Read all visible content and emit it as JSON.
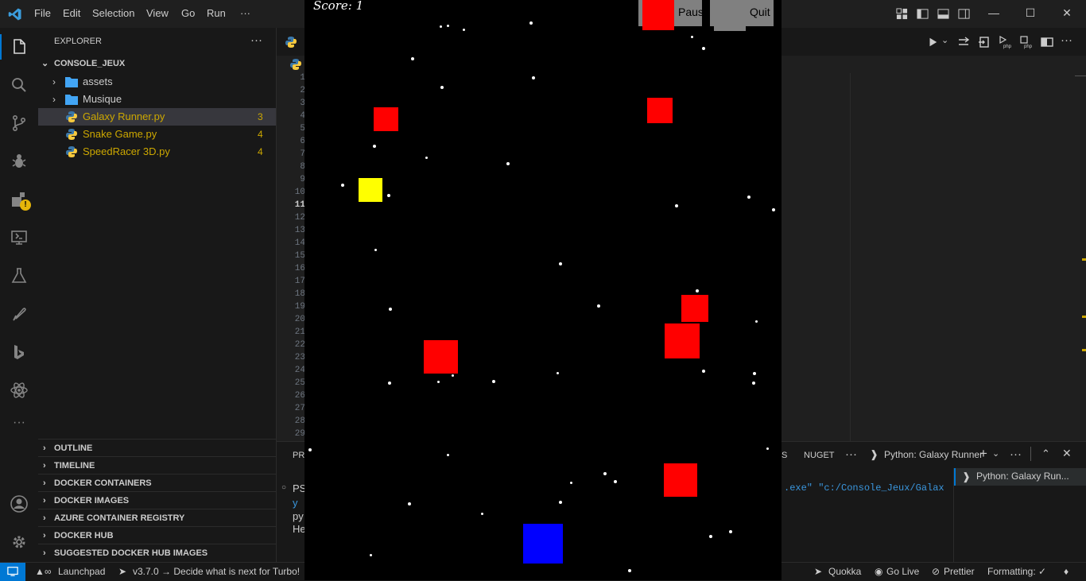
{
  "titlebar": {
    "menu": [
      "File",
      "Edit",
      "Selection",
      "View",
      "Go",
      "Run",
      "···"
    ]
  },
  "sidebar": {
    "header": "EXPLORER",
    "more": "···",
    "root": "CONSOLE_JEUX",
    "folders": [
      "assets",
      "Musique"
    ],
    "files": [
      {
        "name": "Galaxy Runner.py",
        "badge": "3"
      },
      {
        "name": "Snake Game.py",
        "badge": "4"
      },
      {
        "name": "SpeedRacer 3D.py",
        "badge": "4"
      }
    ],
    "sections": [
      "OUTLINE",
      "TIMELINE",
      "DOCKER CONTAINERS",
      "DOCKER IMAGES",
      "AZURE CONTAINER REGISTRY",
      "DOCKER HUB",
      "SUGGESTED DOCKER HUB IMAGES"
    ]
  },
  "editor": {
    "line_numbers": [
      "1",
      "2",
      "3",
      "4",
      "5",
      "6",
      "7",
      "8",
      "9",
      "10",
      "11",
      "12",
      "13",
      "14",
      "15",
      "16",
      "17",
      "18",
      "19",
      "20",
      "21",
      "22",
      "23",
      "24",
      "25",
      "26",
      "27",
      "28",
      "29"
    ],
    "active_line": "11"
  },
  "panel": {
    "tab_partial": "PR",
    "tab_nuget": "NUGET",
    "tab_s": "S",
    "more": "···",
    "terminal_name": "Python: Galaxy Runner",
    "terminal_list_item": "Python: Galaxy Run...",
    "prompt_partial": "PS",
    "line_y": "y",
    "line_py": "py",
    "line_he": "He",
    "cmd_tail": ".exe\" \"c:/Console_Jeux/Galax"
  },
  "game": {
    "score_text": "Score: 1",
    "pause_label": "Paus",
    "quit_label": "Quit",
    "colors": {
      "background": "#000000",
      "enemy": "#ff0000",
      "player": "#0000ff",
      "powerup": "#ffff00",
      "star": "#ffffff",
      "button": "#808080"
    }
  },
  "statusbar": {
    "launchpad": "Launchpad",
    "turbo": "v3.7.0 → Decide what is next for Turbo!",
    "quokka": "Quokka",
    "golive": "Go Live",
    "prettier": "Prettier",
    "formatting": "Formatting: ✓"
  }
}
